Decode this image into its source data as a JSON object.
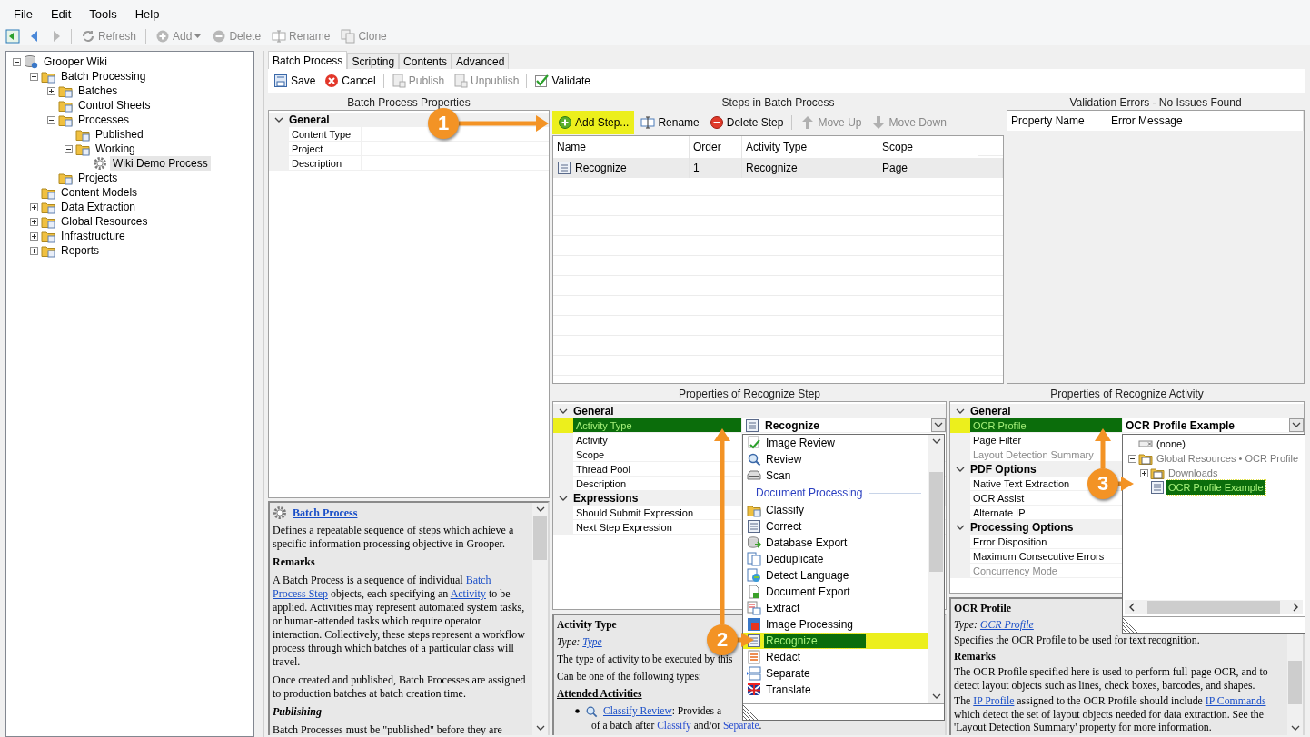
{
  "menu": [
    "File",
    "Edit",
    "Tools",
    "Help"
  ],
  "toolbar": [
    {
      "label": "Refresh",
      "disabled": true,
      "has_menu": false
    },
    {
      "label": "Add",
      "disabled": true,
      "has_menu": true
    },
    {
      "label": "Delete",
      "disabled": true,
      "has_menu": false
    },
    {
      "label": "Rename",
      "disabled": true,
      "has_menu": false
    },
    {
      "label": "Clone",
      "disabled": true,
      "has_menu": false
    }
  ],
  "tree": [
    {
      "label": "Grooper Wiki",
      "expanded": true,
      "selected": false,
      "children": [
        {
          "label": "Batch Processing",
          "expanded": true,
          "selected": false,
          "children": [
            {
              "label": "Batches",
              "expanded": false,
              "selected": false
            },
            {
              "label": "Control Sheets",
              "selected": false
            },
            {
              "label": "Processes",
              "expanded": true,
              "selected": false,
              "children": [
                {
                  "label": "Published",
                  "selected": false
                },
                {
                  "label": "Working",
                  "expanded": true,
                  "selected": false,
                  "children": [
                    {
                      "label": "Wiki Demo Process",
                      "selected": true
                    }
                  ]
                }
              ]
            },
            {
              "label": "Projects",
              "selected": false
            }
          ]
        },
        {
          "label": "Content Models",
          "selected": false
        },
        {
          "label": "Data Extraction",
          "expanded": false,
          "selected": false
        },
        {
          "label": "Global Resources",
          "expanded": false,
          "selected": false
        },
        {
          "label": "Infrastructure",
          "expanded": false,
          "selected": false
        },
        {
          "label": "Reports",
          "expanded": false,
          "selected": false
        }
      ]
    }
  ],
  "tabs": [
    {
      "label": "Batch Process",
      "selected": true
    },
    {
      "label": "Scripting",
      "selected": false
    },
    {
      "label": "Contents",
      "selected": false
    },
    {
      "label": "Advanced",
      "selected": false
    }
  ],
  "editor_toolbar": [
    {
      "label": "Save",
      "disabled": false
    },
    {
      "label": "Cancel",
      "disabled": false
    },
    {
      "label": "Publish",
      "disabled": true
    },
    {
      "label": "Unpublish",
      "disabled": true
    },
    {
      "label": "Validate",
      "disabled": false
    }
  ],
  "batch_process_properties": {
    "title": "Batch Process Properties",
    "groups": [
      {
        "label": "General",
        "expanded": true,
        "rows": [
          {
            "name": "Content Type",
            "selected": false,
            "disabled": false,
            "highlighted": false
          },
          {
            "name": "Project",
            "selected": false,
            "disabled": false,
            "highlighted": false
          },
          {
            "name": "Description",
            "selected": false,
            "disabled": false,
            "highlighted": false
          }
        ]
      }
    ]
  },
  "batch_process_help": [
    {
      "kind": "title",
      "parts": [
        {
          "kind": "link",
          "text": "Batch Process"
        }
      ]
    },
    {
      "kind": "para",
      "parts": [
        {
          "kind": "text",
          "text": "Defines a repeatable sequence of steps which achieve a specific information processing objective in Grooper."
        }
      ]
    },
    {
      "kind": "heading",
      "parts": [
        {
          "kind": "text",
          "text": "Remarks"
        }
      ]
    },
    {
      "kind": "para",
      "parts": [
        {
          "kind": "text",
          "text": "A Batch Process is a sequence of individual "
        },
        {
          "kind": "link",
          "text": "Batch"
        },
        {
          "kind": "link",
          "text": "Process Step"
        },
        {
          "kind": "text",
          "text": " objects, each specifying an "
        },
        {
          "kind": "link",
          "text": "Activity"
        },
        {
          "kind": "text",
          "text": " to be applied. Activities may represent automated system tasks, or human-attended tasks which require operator interaction. Collectively, these steps represent a workflow process through which batches of a particular class will travel."
        }
      ]
    },
    {
      "kind": "para",
      "parts": [
        {
          "kind": "text",
          "text": "Once created and published, Batch Processes are assigned to production batches at batch creation time."
        }
      ]
    },
    {
      "kind": "subheading",
      "parts": [
        {
          "kind": "text",
          "text": "Publishing"
        }
      ]
    },
    {
      "kind": "para",
      "parts": [
        {
          "kind": "text",
          "text": "Batch Processes must be \"published\" before they are"
        }
      ]
    }
  ],
  "steps": {
    "title": "Steps in Batch Process",
    "toolbar": [
      {
        "label": "Add Step...",
        "disabled": false,
        "highlighted": true
      },
      {
        "label": "Rename",
        "disabled": false,
        "highlighted": false
      },
      {
        "label": "Delete Step",
        "disabled": false,
        "highlighted": false
      },
      {
        "label": "Move Up",
        "disabled": true,
        "highlighted": false
      },
      {
        "label": "Move Down",
        "disabled": true,
        "highlighted": false
      }
    ],
    "columns": [
      "Name",
      "Order",
      "Activity Type",
      "Scope"
    ],
    "rows": [
      {
        "cells": [
          "Recognize",
          "1",
          "Recognize",
          "Page"
        ],
        "selected": true
      }
    ]
  },
  "validation": {
    "title": "Validation Errors - No Issues Found",
    "columns": [
      "Property Name",
      "Error Message"
    ]
  },
  "step_properties": {
    "title": "Properties of Recognize Step",
    "groups": [
      {
        "label": "General",
        "expanded": true,
        "rows": [
          {
            "name": "Activity Type",
            "value": "Recognize",
            "selected": true,
            "disabled": false,
            "highlighted": true
          },
          {
            "name": "Activity",
            "selected": false,
            "disabled": false,
            "highlighted": false
          },
          {
            "name": "Scope",
            "selected": false,
            "disabled": false,
            "highlighted": false
          },
          {
            "name": "Thread Pool",
            "selected": false,
            "disabled": false,
            "highlighted": false
          },
          {
            "name": "Description",
            "selected": false,
            "disabled": false,
            "highlighted": false
          }
        ]
      },
      {
        "label": "Expressions",
        "expanded": true,
        "rows": [
          {
            "name": "Should Submit Expression",
            "selected": false,
            "disabled": false,
            "highlighted": false
          },
          {
            "name": "Next Step Expression",
            "selected": false,
            "disabled": false,
            "highlighted": false
          }
        ]
      }
    ]
  },
  "activity_type_list": [
    {
      "kind": "item",
      "label": "Image Review",
      "selected": false
    },
    {
      "kind": "item",
      "label": "Review",
      "selected": false
    },
    {
      "kind": "item",
      "label": "Scan",
      "selected": false
    },
    {
      "kind": "header",
      "label": "Document Processing"
    },
    {
      "kind": "item",
      "label": "Classify",
      "selected": false
    },
    {
      "kind": "item",
      "label": "Correct",
      "selected": false
    },
    {
      "kind": "item",
      "label": "Database Export",
      "selected": false
    },
    {
      "kind": "item",
      "label": "Deduplicate",
      "selected": false
    },
    {
      "kind": "item",
      "label": "Detect Language",
      "selected": false
    },
    {
      "kind": "item",
      "label": "Document Export",
      "selected": false
    },
    {
      "kind": "item",
      "label": "Extract",
      "selected": false
    },
    {
      "kind": "item",
      "label": "Image Processing",
      "selected": false
    },
    {
      "kind": "item",
      "label": "Recognize",
      "selected": true
    },
    {
      "kind": "item",
      "label": "Redact",
      "selected": false
    },
    {
      "kind": "item",
      "label": "Separate",
      "selected": false
    },
    {
      "kind": "item",
      "label": "Translate",
      "selected": false
    }
  ],
  "step_help": [
    {
      "kind": "heading",
      "parts": [
        {
          "kind": "text",
          "text": "Activity Type"
        }
      ]
    },
    {
      "kind": "type",
      "parts": [
        {
          "kind": "text",
          "text": "Type: "
        },
        {
          "kind": "link",
          "text": "Type"
        }
      ]
    },
    {
      "kind": "line",
      "parts": [
        {
          "kind": "text",
          "text": "The type of activity to be executed by this"
        }
      ]
    },
    {
      "kind": "line",
      "parts": [
        {
          "kind": "text",
          "text": "Can be one of the following types:"
        }
      ]
    },
    {
      "kind": "section",
      "parts": [
        {
          "kind": "text",
          "text": "Attended Activities"
        }
      ]
    },
    {
      "kind": "bullet",
      "parts": [
        {
          "kind": "link",
          "text": "Classify Review"
        },
        {
          "kind": "text",
          "text": ": Provides a"
        }
      ]
    },
    {
      "kind": "indent",
      "parts": [
        {
          "kind": "text",
          "text": "of a batch after "
        },
        {
          "kind": "link",
          "text": "Classify"
        },
        {
          "kind": "text",
          "text": " and/or "
        },
        {
          "kind": "link",
          "text": "Separate"
        },
        {
          "kind": "text",
          "text": "."
        }
      ]
    }
  ],
  "activity_properties": {
    "title": "Properties of Recognize Activity",
    "groups": [
      {
        "label": "General",
        "expanded": true,
        "rows": [
          {
            "name": "OCR Profile",
            "value": "OCR Profile Example",
            "selected": true,
            "disabled": false,
            "highlighted": true
          },
          {
            "name": "Page Filter",
            "selected": false,
            "disabled": false,
            "highlighted": false
          },
          {
            "name": "Layout Detection Summary",
            "selected": false,
            "disabled": true,
            "highlighted": false
          }
        ]
      },
      {
        "label": "PDF Options",
        "expanded": true,
        "rows": [
          {
            "name": "Native Text Extraction",
            "selected": false,
            "disabled": false,
            "highlighted": false
          },
          {
            "name": "OCR Assist",
            "selected": false,
            "disabled": false,
            "highlighted": false
          },
          {
            "name": "Alternate IP",
            "selected": false,
            "disabled": false,
            "highlighted": false
          }
        ]
      },
      {
        "label": "Processing Options",
        "expanded": true,
        "rows": [
          {
            "name": "Error Disposition",
            "selected": false,
            "disabled": false,
            "highlighted": false
          },
          {
            "name": "Maximum Consecutive Errors",
            "selected": false,
            "disabled": false,
            "highlighted": false
          },
          {
            "name": "Concurrency Mode",
            "selected": false,
            "disabled": true,
            "highlighted": false
          }
        ]
      }
    ]
  },
  "ocr_profile_tree": [
    {
      "label": "(none)",
      "selected": false,
      "disabled": false
    },
    {
      "label": "Global Resources • OCR Profile",
      "expanded": true,
      "selected": false,
      "disabled": true,
      "children": [
        {
          "label": "Downloads",
          "expanded": false,
          "selected": false,
          "disabled": true
        },
        {
          "label": "OCR Profile Example",
          "selected": true,
          "disabled": false
        }
      ]
    }
  ],
  "activity_help": [
    {
      "kind": "heading",
      "parts": [
        {
          "kind": "text",
          "text": "OCR Profile"
        }
      ]
    },
    {
      "kind": "type",
      "parts": [
        {
          "kind": "text",
          "text": "Type: "
        },
        {
          "kind": "link",
          "text": "OCR Profile"
        }
      ]
    },
    {
      "kind": "para",
      "parts": [
        {
          "kind": "text",
          "text": "Specifies the OCR Profile to be used for text recognition."
        }
      ]
    },
    {
      "kind": "heading",
      "parts": [
        {
          "kind": "text",
          "text": "Remarks"
        }
      ]
    },
    {
      "kind": "para",
      "parts": [
        {
          "kind": "text",
          "text": "The OCR Profile specified here is used to perform full-page OCR, and to detect layout objects such as lines, check boxes, barcodes, and shapes."
        }
      ]
    },
    {
      "kind": "para",
      "parts": [
        {
          "kind": "text",
          "text": "The "
        },
        {
          "kind": "link",
          "text": "IP Profile"
        },
        {
          "kind": "text",
          "text": " assigned to the OCR Profile should include "
        },
        {
          "kind": "link",
          "text": "IP Commands"
        },
        {
          "kind": "text",
          "text": " which detect the set of layout objects needed for data extraction. See the 'Layout Detection Summary' property for more information."
        }
      ]
    }
  ],
  "annotations": [
    "1",
    "2",
    "3"
  ]
}
